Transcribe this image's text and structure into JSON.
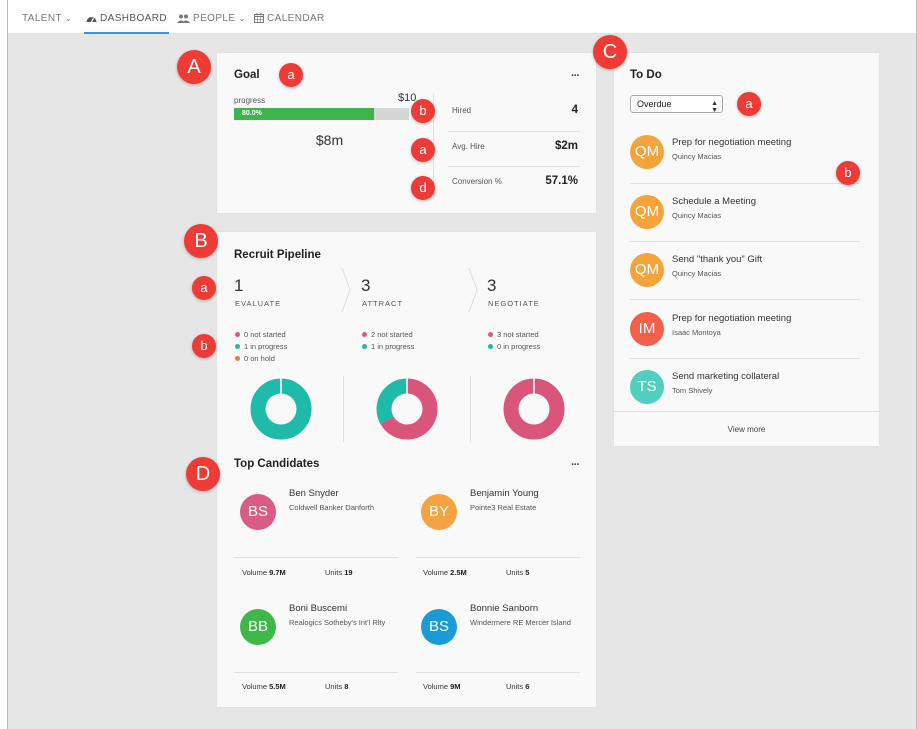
{
  "nav": {
    "items": [
      {
        "label": "TALENT",
        "icon": "chevron-down-icon"
      },
      {
        "label": "DASHBOARD",
        "icon": "dashboard-icon"
      },
      {
        "label": "PEOPLE",
        "icon": "people-icon"
      },
      {
        "label": "CALENDAR",
        "icon": "calendar-icon"
      }
    ],
    "active": "DASHBOARD"
  },
  "markers": {
    "A": "A",
    "B": "B",
    "C": "C",
    "D": "D",
    "a": "a",
    "b": "b",
    "d": "d"
  },
  "goal": {
    "title": "Goal",
    "more": "···",
    "progress_label": "progress",
    "target": "$10",
    "progress_percent": 80.0,
    "progress_text": "80.0%",
    "current": "$8m",
    "stats": [
      {
        "label": "Hired",
        "value": "4"
      },
      {
        "label": "Avg. Hire",
        "value": "$2m"
      },
      {
        "label": "Conversion %",
        "value": "57.1%"
      }
    ]
  },
  "pipeline": {
    "title": "Recruit Pipeline",
    "stages": [
      {
        "count": "1",
        "label": "EVALUATE",
        "lines": [
          {
            "text": "0 not started",
            "color": "#e2567c"
          },
          {
            "text": "1 in progress",
            "color": "#22b8a8"
          },
          {
            "text": "0 on hold",
            "color": "#f07a3a"
          }
        ],
        "donut": [
          {
            "value": 0,
            "color": "#d9557a"
          },
          {
            "value": 1,
            "color": "#1ebbab"
          }
        ]
      },
      {
        "count": "3",
        "label": "ATTRACT",
        "lines": [
          {
            "text": "2 not started",
            "color": "#e2567c"
          },
          {
            "text": "1 in progress",
            "color": "#22b8a8"
          }
        ],
        "donut": [
          {
            "value": 2,
            "color": "#d9557a"
          },
          {
            "value": 1,
            "color": "#1ebbab"
          }
        ]
      },
      {
        "count": "3",
        "label": "NEGOTIATE",
        "lines": [
          {
            "text": "3 not started",
            "color": "#e2567c"
          },
          {
            "text": "0 in progress",
            "color": "#22b8a8"
          }
        ],
        "donut": [
          {
            "value": 3,
            "color": "#d9557a"
          },
          {
            "value": 0,
            "color": "#1ebbab"
          }
        ]
      }
    ]
  },
  "candidates": {
    "title": "Top Candidates",
    "more": "···",
    "volume_label": "Volume",
    "units_label": "Units",
    "items": [
      {
        "initials": "BS",
        "name": "Ben Snyder",
        "company": "Coldwell Banker Danforth",
        "volume": "9.7M",
        "units": "19",
        "color": "#d95c86"
      },
      {
        "initials": "BY",
        "name": "Benjamin Young",
        "company": "Pointe3 Real Estate",
        "volume": "2.5M",
        "units": "5",
        "color": "#f5a340"
      },
      {
        "initials": "BB",
        "name": "Boni Buscemi",
        "company": "Realogics Sotheby's Int'l Rlty",
        "volume": "5.5M",
        "units": "8",
        "color": "#3fb84a"
      },
      {
        "initials": "BS",
        "name": "Bonnie Sanborn",
        "company": "Windermere RE Mercer Island",
        "volume": "9M",
        "units": "6",
        "color": "#1b9bd5"
      }
    ]
  },
  "todo": {
    "title": "To Do",
    "filter": "Overdue",
    "view_more": "View more",
    "items": [
      {
        "initials": "QM",
        "title": "Prep for negotiation meeting",
        "person": "Quincy Macias",
        "color": "#f5a33a"
      },
      {
        "initials": "QM",
        "title": "Schedule a Meeting",
        "person": "Quincy Macias",
        "color": "#f5a33a"
      },
      {
        "initials": "QM",
        "title": "Send \"thank you\" Gift",
        "person": "Quincy Macias",
        "color": "#f5a33a"
      },
      {
        "initials": "IM",
        "title": "Prep for negotiation meeting",
        "person": "Isaac Montoya",
        "color": "#f0604a"
      },
      {
        "initials": "TS",
        "title": "Send marketing collateral",
        "person": "Tom Shively",
        "color": "#4fcfbf"
      }
    ]
  }
}
